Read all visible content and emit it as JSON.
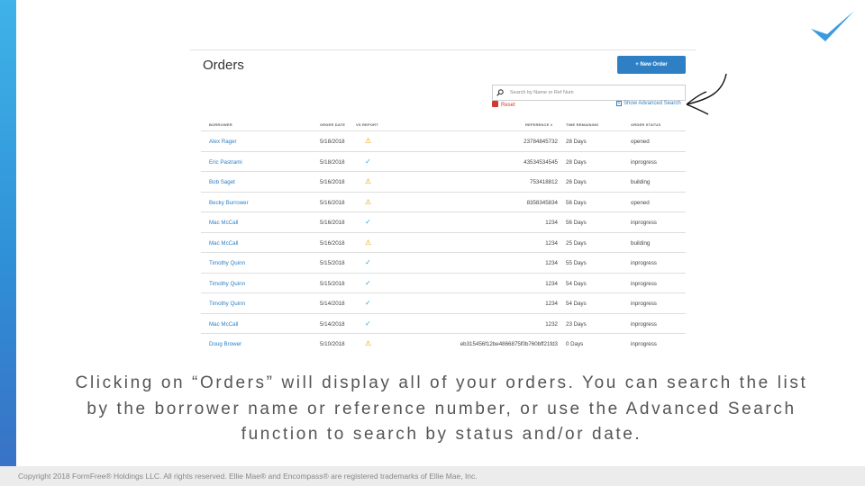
{
  "app": {
    "title": "Orders",
    "new_order_label": "+ New Order"
  },
  "search": {
    "placeholder": "Search by Name or Ref Num",
    "reset_label": "Reset",
    "advanced_label": "Show Advanced Search"
  },
  "columns": {
    "borrower": "BORROWER",
    "order_date": "ORDER DATE",
    "vs_report": "VS REPORT",
    "reference": "REFERENCE #",
    "time_remaining": "TIME REMAINING",
    "order_status": "ORDER STATUS"
  },
  "rows": [
    {
      "borrower": "Alex Rager",
      "date": "5/18/2018",
      "report": "warning",
      "ref": "23784845732",
      "time": "28 Days",
      "status": "opened"
    },
    {
      "borrower": "Eric Pastrami",
      "date": "5/18/2018",
      "report": "check",
      "ref": "43534534545",
      "time": "28 Days",
      "status": "inprogress"
    },
    {
      "borrower": "Bob Saget",
      "date": "5/16/2018",
      "report": "warning",
      "ref": "753418812",
      "time": "26 Days",
      "status": "building"
    },
    {
      "borrower": "Becky Burrower",
      "date": "5/16/2018",
      "report": "warning",
      "ref": "8358345834",
      "time": "56 Days",
      "status": "opened"
    },
    {
      "borrower": "Mac McCall",
      "date": "5/16/2018",
      "report": "check",
      "ref": "1234",
      "time": "56 Days",
      "status": "inprogress"
    },
    {
      "borrower": "Mac McCall",
      "date": "5/16/2018",
      "report": "warning",
      "ref": "1234",
      "time": "25 Days",
      "status": "building"
    },
    {
      "borrower": "Timothy Quinn",
      "date": "5/15/2018",
      "report": "check",
      "ref": "1234",
      "time": "55 Days",
      "status": "inprogress"
    },
    {
      "borrower": "Timothy Quinn",
      "date": "5/15/2018",
      "report": "check",
      "ref": "1234",
      "time": "54 Days",
      "status": "inprogress"
    },
    {
      "borrower": "Timothy Quinn",
      "date": "5/14/2018",
      "report": "check",
      "ref": "1234",
      "time": "54 Days",
      "status": "inprogress"
    },
    {
      "borrower": "Mac McCall",
      "date": "5/14/2018",
      "report": "check",
      "ref": "1232",
      "time": "23 Days",
      "status": "inprogress"
    },
    {
      "borrower": "Doug Brower",
      "date": "5/10/2018",
      "report": "warning",
      "ref": "eb315456f12be4866875f0b760bff21fd3",
      "time": "0 Days",
      "status": "inprogress"
    }
  ],
  "icons": {
    "warning": "⚠",
    "check": "✓"
  },
  "caption": "Clicking on “Orders” will display all of your orders. You can search the list by the borrower name or reference number, or use the Advanced Search function to search by status and/or date.",
  "footer": "Copyright 2018 FormFree® Holdings LLC. All rights reserved. Ellie Mae® and Encompass® are registered trademarks of Ellie Mae, Inc.",
  "colors": {
    "accent": "#2f7fc4",
    "warning": "#e2a300",
    "check": "#3aa0d8",
    "reset": "#d13a2f"
  }
}
